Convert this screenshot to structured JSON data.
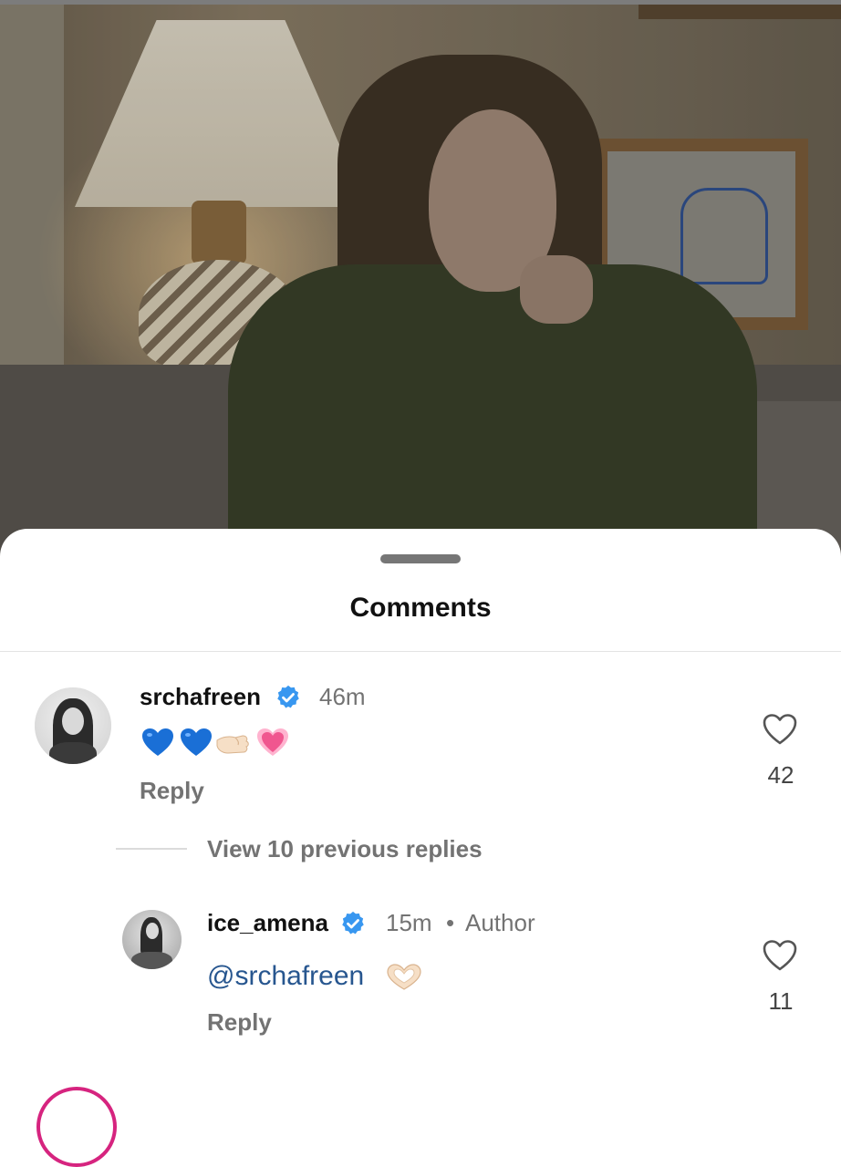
{
  "sheet": {
    "title": "Comments"
  },
  "comments": [
    {
      "username": "srchafreen",
      "verified": true,
      "time": "46m",
      "text_emoji": [
        "blue-heart-emoji",
        "blue-heart-emoji",
        "pinching-hand-emoji",
        "growing-heart-emoji"
      ],
      "reply_label": "Reply",
      "likes": "42"
    },
    {
      "username": "ice_amena",
      "verified": true,
      "time": "15m",
      "separator": "•",
      "author_tag": "Author",
      "mention": "@srchafreen",
      "trailing_emoji": "heart-hands-emoji",
      "reply_label": "Reply",
      "likes": "11"
    }
  ],
  "view_replies": "View 10 previous replies",
  "colors": {
    "verified_badge": "#3897f0",
    "mention": "#27568f",
    "secondary_text": "#737373",
    "blue_heart": "#1a6fd6",
    "pink_heart": "#f0568f"
  }
}
